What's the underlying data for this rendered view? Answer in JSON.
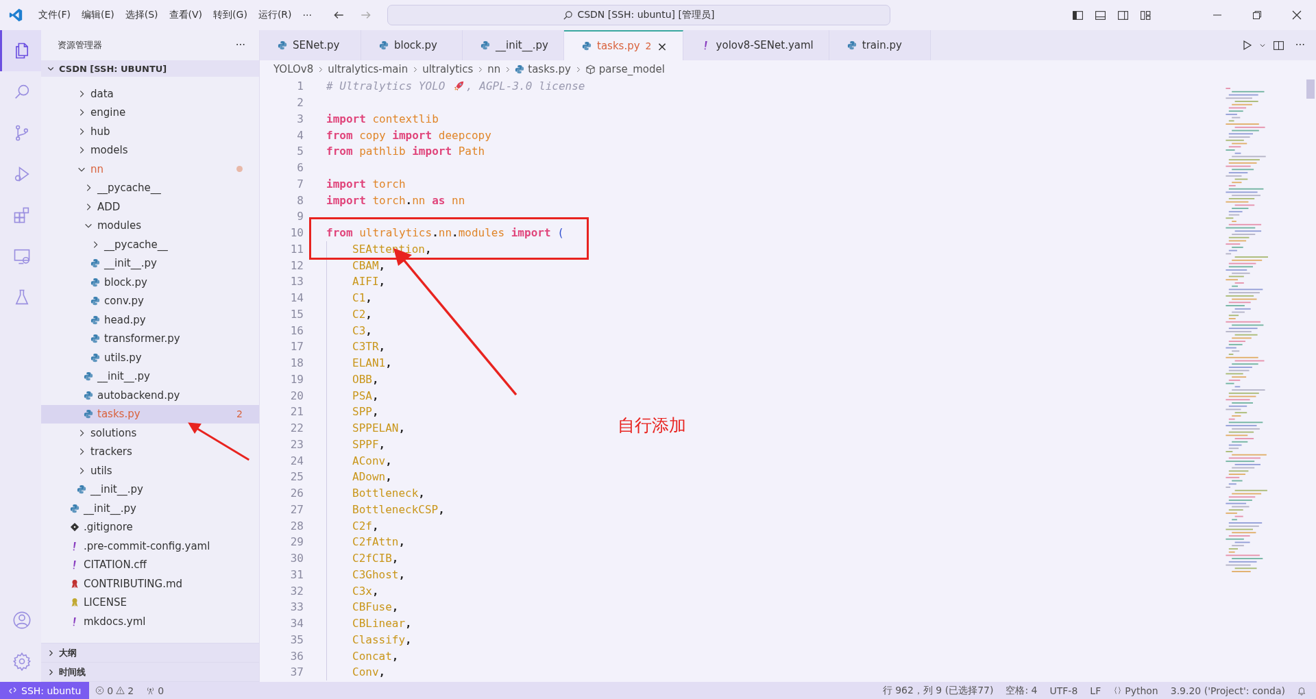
{
  "title_bar": {
    "menus": [
      "文件(F)",
      "编辑(E)",
      "选择(S)",
      "查看(V)",
      "转到(G)",
      "运行(R)"
    ],
    "more": "···",
    "search": "CSDN [SSH: ubuntu] [管理员]"
  },
  "activity_bar": [
    {
      "kind": "explorer",
      "selected": true
    },
    {
      "kind": "search",
      "selected": false
    },
    {
      "kind": "source-control",
      "selected": false
    },
    {
      "kind": "run",
      "selected": false
    },
    {
      "kind": "extensions",
      "selected": false
    },
    {
      "kind": "remote",
      "selected": false
    },
    {
      "kind": "testing",
      "selected": false
    }
  ],
  "explorer": {
    "title": "资源管理器",
    "more": "···",
    "section": "CSDN [SSH: UBUNTU]",
    "tree": [
      {
        "kind": "hidden-parent",
        "children": [
          {
            "kind": "folder",
            "label": "data",
            "expanded": false
          },
          {
            "kind": "folder",
            "label": "engine",
            "expanded": false
          },
          {
            "kind": "folder",
            "label": "hub",
            "expanded": false
          },
          {
            "kind": "folder",
            "label": "models",
            "expanded": false
          },
          {
            "kind": "folder",
            "label": "nn",
            "expanded": true,
            "modified": true,
            "children": [
              {
                "kind": "folder",
                "label": "__pycache__",
                "expanded": false
              },
              {
                "kind": "folder",
                "label": "ADD",
                "expanded": false
              },
              {
                "kind": "folder",
                "label": "modules",
                "expanded": true,
                "children": [
                  {
                    "kind": "folder",
                    "label": "__pycache__",
                    "expanded": false
                  },
                  {
                    "kind": "python",
                    "label": "__init__.py"
                  },
                  {
                    "kind": "python",
                    "label": "block.py"
                  },
                  {
                    "kind": "python",
                    "label": "conv.py"
                  },
                  {
                    "kind": "python",
                    "label": "head.py"
                  },
                  {
                    "kind": "python",
                    "label": "transformer.py"
                  },
                  {
                    "kind": "python",
                    "label": "utils.py"
                  }
                ]
              },
              {
                "kind": "python",
                "label": "__init__.py"
              },
              {
                "kind": "python",
                "label": "autobackend.py"
              },
              {
                "kind": "python",
                "label": "tasks.py",
                "selected": true,
                "modified": true,
                "badge": "2"
              }
            ]
          },
          {
            "kind": "folder",
            "label": "solutions",
            "expanded": false
          },
          {
            "kind": "folder",
            "label": "trackers",
            "expanded": false
          },
          {
            "kind": "folder",
            "label": "utils",
            "expanded": false
          },
          {
            "kind": "python",
            "label": "__init__.py"
          }
        ]
      },
      {
        "kind": "python",
        "label": "__init__.py"
      },
      {
        "kind": "git",
        "label": ".gitignore"
      },
      {
        "kind": "yaml",
        "label": ".pre-commit-config.yaml"
      },
      {
        "kind": "yaml",
        "label": "CITATION.cff"
      },
      {
        "kind": "ribbon",
        "label": "CONTRIBUTING.md"
      },
      {
        "kind": "license",
        "label": "LICENSE"
      },
      {
        "kind": "yaml",
        "label": "mkdocs.yml"
      }
    ],
    "panels": [
      {
        "label": "大纲",
        "expanded": false
      },
      {
        "label": "时间线",
        "expanded": false
      }
    ]
  },
  "tabs": [
    {
      "label": "SENet.py",
      "kind": "python",
      "selected": false
    },
    {
      "label": "block.py",
      "kind": "python",
      "selected": false
    },
    {
      "label": "__init__.py",
      "kind": "python",
      "selected": false
    },
    {
      "label": "tasks.py",
      "kind": "python",
      "selected": true,
      "modified": true,
      "badge": "2",
      "close": "×"
    },
    {
      "label": "yolov8-SENet.yaml",
      "kind": "yaml",
      "selected": false
    },
    {
      "label": "train.py",
      "kind": "python",
      "selected": false
    }
  ],
  "breadcrumb": [
    "YOLOv8",
    "ultralytics-main",
    "ultralytics",
    "nn",
    "tasks.py",
    "parse_model"
  ],
  "code": [
    {
      "n": "1",
      "tokens": [
        {
          "t": "# Ultralytics YOLO ",
          "kind": "comment"
        },
        {
          "kind": "rocket"
        },
        {
          "t": ", AGPL-3.0 license",
          "kind": "comment"
        }
      ]
    },
    {
      "n": "2"
    },
    {
      "n": "3",
      "tokens": [
        {
          "t": "import",
          "kind": "kw"
        },
        {
          "t": " contextlib",
          "kind": "mod"
        }
      ]
    },
    {
      "n": "4",
      "tokens": [
        {
          "t": "from",
          "kind": "kw"
        },
        {
          "t": " copy ",
          "kind": "mod"
        },
        {
          "t": "import",
          "kind": "kw"
        },
        {
          "t": " deepcopy",
          "kind": "mod"
        }
      ]
    },
    {
      "n": "5",
      "tokens": [
        {
          "t": "from",
          "kind": "kw"
        },
        {
          "t": " pathlib ",
          "kind": "mod"
        },
        {
          "t": "import",
          "kind": "kw"
        },
        {
          "t": " Path",
          "kind": "mod"
        }
      ]
    },
    {
      "n": "6"
    },
    {
      "n": "7",
      "tokens": [
        {
          "t": "import",
          "kind": "kw"
        },
        {
          "t": " torch",
          "kind": "mod"
        }
      ]
    },
    {
      "n": "8",
      "tokens": [
        {
          "t": "import",
          "kind": "kw"
        },
        {
          "t": " torch",
          "kind": "mod"
        },
        {
          "t": ".",
          "kind": "punct"
        },
        {
          "t": "nn ",
          "kind": "mod"
        },
        {
          "t": "as",
          "kind": "kw"
        },
        {
          "t": " nn",
          "kind": "mod"
        }
      ]
    },
    {
      "n": "9"
    },
    {
      "n": "10",
      "tokens": [
        {
          "t": "from",
          "kind": "kw"
        },
        {
          "t": " ultralytics",
          "kind": "mod"
        },
        {
          "t": ".",
          "kind": "punct"
        },
        {
          "t": "nn",
          "kind": "mod"
        },
        {
          "t": ".",
          "kind": "punct"
        },
        {
          "t": "modules ",
          "kind": "mod"
        },
        {
          "t": "import",
          "kind": "kw"
        },
        {
          "t": " (",
          "kind": "paren"
        }
      ]
    },
    {
      "n": "11",
      "indented": true,
      "tokens": [
        {
          "t": "SEAttention",
          "kind": "name"
        },
        {
          "t": ",",
          "kind": "punct"
        }
      ]
    },
    {
      "n": "12",
      "indented": true,
      "tokens": [
        {
          "t": "CBAM",
          "kind": "name"
        },
        {
          "t": ",",
          "kind": "punct"
        }
      ]
    },
    {
      "n": "13",
      "indented": true,
      "tokens": [
        {
          "t": "AIFI",
          "kind": "name"
        },
        {
          "t": ",",
          "kind": "punct"
        }
      ]
    },
    {
      "n": "14",
      "indented": true,
      "tokens": [
        {
          "t": "C1",
          "kind": "name"
        },
        {
          "t": ",",
          "kind": "punct"
        }
      ]
    },
    {
      "n": "15",
      "indented": true,
      "tokens": [
        {
          "t": "C2",
          "kind": "name"
        },
        {
          "t": ",",
          "kind": "punct"
        }
      ]
    },
    {
      "n": "16",
      "indented": true,
      "tokens": [
        {
          "t": "C3",
          "kind": "name"
        },
        {
          "t": ",",
          "kind": "punct"
        }
      ]
    },
    {
      "n": "17",
      "indented": true,
      "tokens": [
        {
          "t": "C3TR",
          "kind": "name"
        },
        {
          "t": ",",
          "kind": "punct"
        }
      ]
    },
    {
      "n": "18",
      "indented": true,
      "tokens": [
        {
          "t": "ELAN1",
          "kind": "name"
        },
        {
          "t": ",",
          "kind": "punct"
        }
      ]
    },
    {
      "n": "19",
      "indented": true,
      "tokens": [
        {
          "t": "OBB",
          "kind": "name"
        },
        {
          "t": ",",
          "kind": "punct"
        }
      ]
    },
    {
      "n": "20",
      "indented": true,
      "tokens": [
        {
          "t": "PSA",
          "kind": "name"
        },
        {
          "t": ",",
          "kind": "punct"
        }
      ]
    },
    {
      "n": "21",
      "indented": true,
      "tokens": [
        {
          "t": "SPP",
          "kind": "name"
        },
        {
          "t": ",",
          "kind": "punct"
        }
      ]
    },
    {
      "n": "22",
      "indented": true,
      "tokens": [
        {
          "t": "SPPELAN",
          "kind": "name"
        },
        {
          "t": ",",
          "kind": "punct"
        }
      ]
    },
    {
      "n": "23",
      "indented": true,
      "tokens": [
        {
          "t": "SPPF",
          "kind": "name"
        },
        {
          "t": ",",
          "kind": "punct"
        }
      ]
    },
    {
      "n": "24",
      "indented": true,
      "tokens": [
        {
          "t": "AConv",
          "kind": "name"
        },
        {
          "t": ",",
          "kind": "punct"
        }
      ]
    },
    {
      "n": "25",
      "indented": true,
      "tokens": [
        {
          "t": "ADown",
          "kind": "name"
        },
        {
          "t": ",",
          "kind": "punct"
        }
      ]
    },
    {
      "n": "26",
      "indented": true,
      "tokens": [
        {
          "t": "Bottleneck",
          "kind": "name"
        },
        {
          "t": ",",
          "kind": "punct"
        }
      ]
    },
    {
      "n": "27",
      "indented": true,
      "tokens": [
        {
          "t": "BottleneckCSP",
          "kind": "name"
        },
        {
          "t": ",",
          "kind": "punct"
        }
      ]
    },
    {
      "n": "28",
      "indented": true,
      "tokens": [
        {
          "t": "C2f",
          "kind": "name"
        },
        {
          "t": ",",
          "kind": "punct"
        }
      ]
    },
    {
      "n": "29",
      "indented": true,
      "tokens": [
        {
          "t": "C2fAttn",
          "kind": "name"
        },
        {
          "t": ",",
          "kind": "punct"
        }
      ]
    },
    {
      "n": "30",
      "indented": true,
      "tokens": [
        {
          "t": "C2fCIB",
          "kind": "name"
        },
        {
          "t": ",",
          "kind": "punct"
        }
      ]
    },
    {
      "n": "31",
      "indented": true,
      "tokens": [
        {
          "t": "C3Ghost",
          "kind": "name"
        },
        {
          "t": ",",
          "kind": "punct"
        }
      ]
    },
    {
      "n": "32",
      "indented": true,
      "tokens": [
        {
          "t": "C3x",
          "kind": "name"
        },
        {
          "t": ",",
          "kind": "punct"
        }
      ]
    },
    {
      "n": "33",
      "indented": true,
      "tokens": [
        {
          "t": "CBFuse",
          "kind": "name"
        },
        {
          "t": ",",
          "kind": "punct"
        }
      ]
    },
    {
      "n": "34",
      "indented": true,
      "tokens": [
        {
          "t": "CBLinear",
          "kind": "name"
        },
        {
          "t": ",",
          "kind": "punct"
        }
      ]
    },
    {
      "n": "35",
      "indented": true,
      "tokens": [
        {
          "t": "Classify",
          "kind": "name"
        },
        {
          "t": ",",
          "kind": "punct"
        }
      ]
    },
    {
      "n": "36",
      "indented": true,
      "tokens": [
        {
          "t": "Concat",
          "kind": "name"
        },
        {
          "t": ",",
          "kind": "punct"
        }
      ]
    },
    {
      "n": "37",
      "indented": true,
      "tokens": [
        {
          "t": "Conv",
          "kind": "name"
        },
        {
          "t": ",",
          "kind": "punct"
        }
      ]
    }
  ],
  "annotation": {
    "text": "自行添加"
  },
  "status_bar": {
    "remote": "SSH: ubuntu",
    "errors": "0",
    "warnings": "2",
    "ports": "0",
    "right": [
      {
        "kind": "text",
        "label": "行 962，列 9 (已选择77)"
      },
      {
        "kind": "text",
        "label": "空格: 4"
      },
      {
        "kind": "text",
        "label": "UTF-8"
      },
      {
        "kind": "text",
        "label": "LF"
      },
      {
        "kind": "language",
        "label": "Python"
      },
      {
        "kind": "text",
        "label": "3.9.20 ('Project': conda)"
      },
      {
        "kind": "bell"
      }
    ]
  }
}
